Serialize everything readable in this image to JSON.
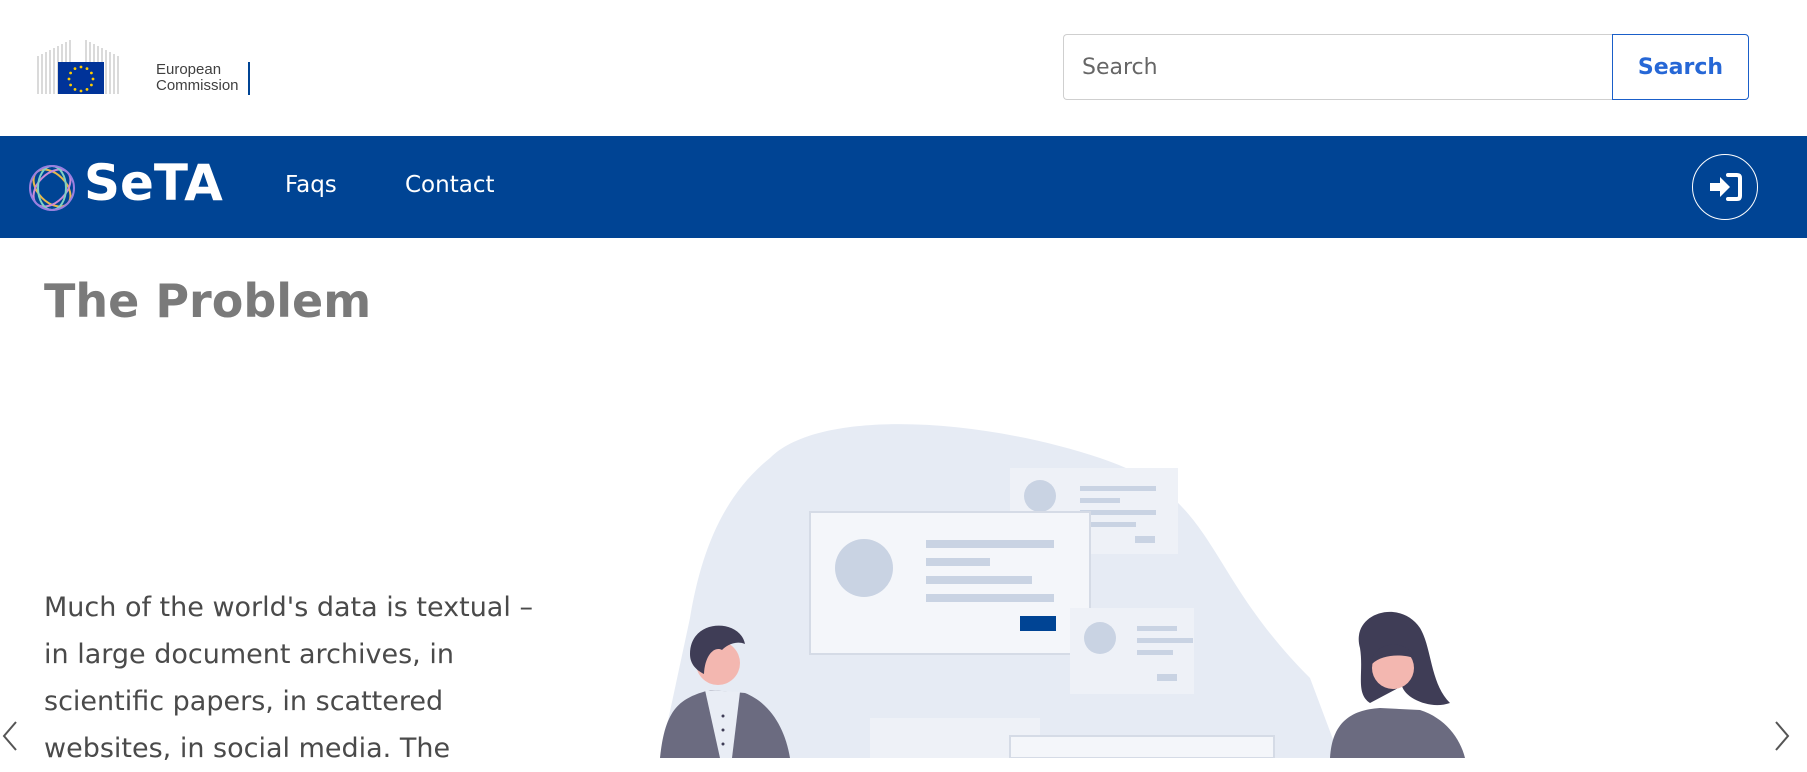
{
  "header": {
    "org_line1": "European",
    "org_line2": "Commission",
    "search": {
      "placeholder": "Search",
      "button_label": "Search"
    }
  },
  "navbar": {
    "app_name": "SeTA",
    "links": [
      {
        "label": "Faqs"
      },
      {
        "label": "Contact"
      }
    ],
    "login_icon": "sign-in-icon",
    "background": "#004494"
  },
  "slide": {
    "title": "The Problem",
    "text": "Much of the world's data is textual – in large document archives, in scientific papers, in scattered websites, in social media. The"
  },
  "carousel": {
    "prev_icon": "chevron-left-icon",
    "next_icon": "chevron-right-icon"
  }
}
